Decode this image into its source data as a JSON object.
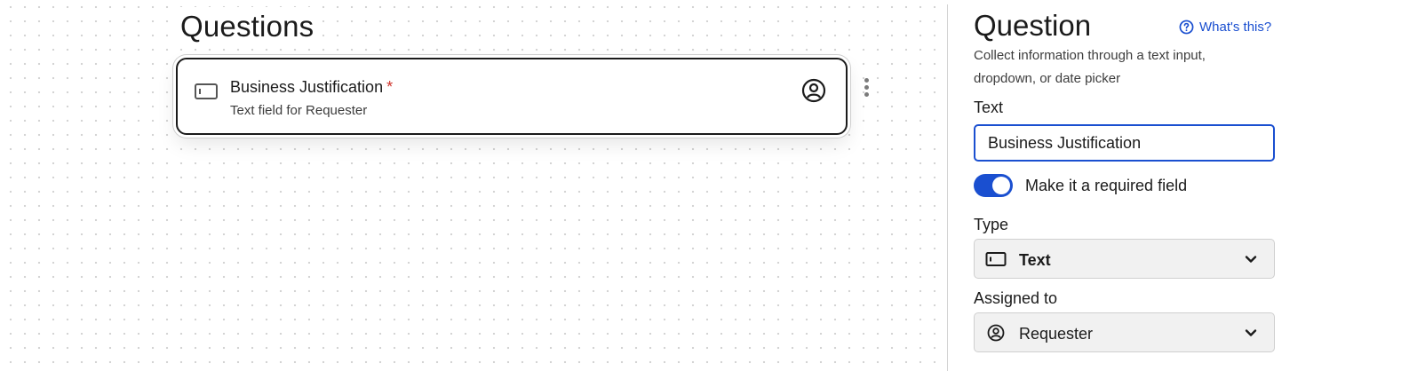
{
  "canvas": {
    "title": "Questions",
    "question": {
      "title": "Business Justification",
      "required_mark": "*",
      "subtitle": "Text field for Requester",
      "icon": "text-field-icon",
      "assignee_icon": "user-circle-icon"
    }
  },
  "panel": {
    "title": "Question",
    "help_link": "What's this?",
    "description": "Collect information through a text input, dropdown, or date picker",
    "text_label": "Text",
    "text_value": "Business Justification",
    "required_toggle": {
      "label": "Make it a required field",
      "on": true
    },
    "type_label": "Type",
    "type_value": "Text",
    "assigned_label": "Assigned to",
    "assigned_value": "Requester"
  },
  "colors": {
    "accent": "#1a4fd0",
    "required": "#d0342c",
    "select_bg": "#f1f1f1",
    "text": "#1b1b1b"
  }
}
